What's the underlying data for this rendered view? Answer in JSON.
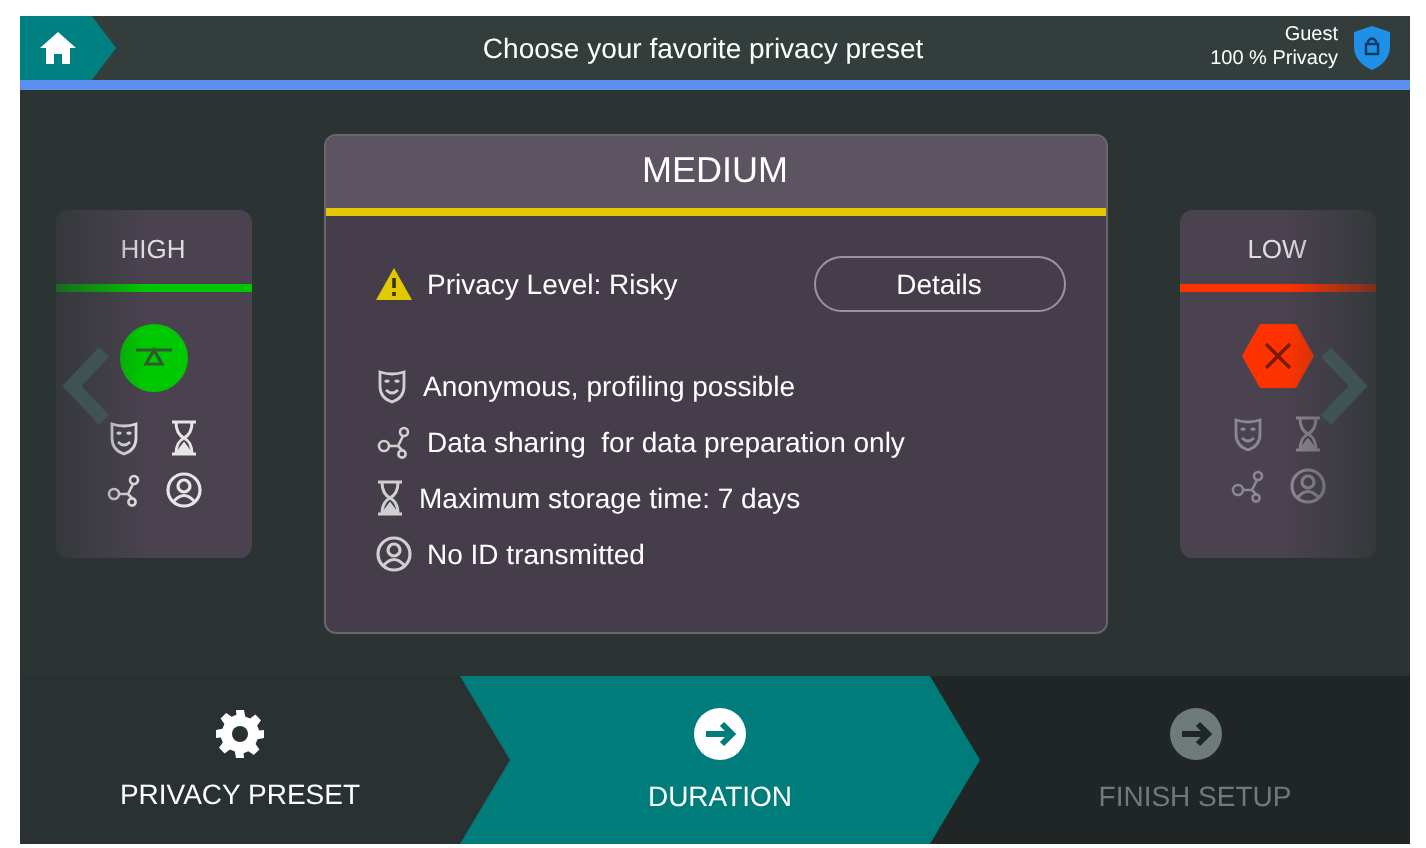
{
  "header": {
    "title": "Choose your favorite privacy preset",
    "user": "Guest",
    "privacy": "100 % Privacy"
  },
  "presets": [
    {
      "title": "HIGH",
      "color": "#00c800",
      "kind": "ok",
      "selected": false
    },
    {
      "title": "MEDIUM",
      "color": "#e2c800",
      "kind": "warning",
      "selected": true,
      "level_text": "Privacy Level: Risky",
      "button": "Details",
      "features": [
        "Anonymous, profiling possible",
        "Data sharing  for data preparation only",
        "Maximum storage time: 7 days",
        "No ID transmitted"
      ]
    },
    {
      "title": "LOW",
      "color": "#ff3300",
      "kind": "danger",
      "selected": false
    }
  ],
  "steps": [
    {
      "label": "PRIVACY PRESET",
      "selected": false,
      "disabled": false
    },
    {
      "label": "DURATION",
      "selected": true,
      "disabled": false
    },
    {
      "label": "FINISH SETUP",
      "selected": false,
      "disabled": true
    }
  ]
}
